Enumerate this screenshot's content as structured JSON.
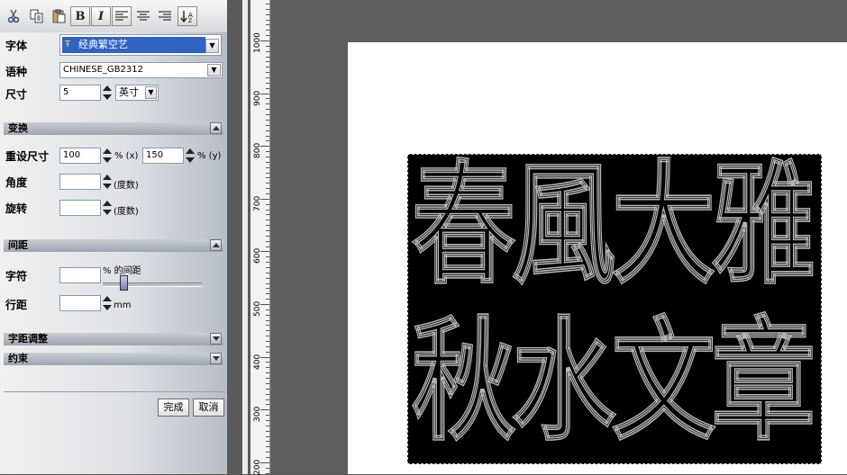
{
  "toolbar": {
    "buttons": [
      {
        "name": "cut-icon",
        "glyph": "✂"
      },
      {
        "name": "copy-icon",
        "glyph": "⎘"
      },
      {
        "name": "paste-icon",
        "glyph": "📋"
      },
      {
        "name": "bold-button",
        "glyph": "B"
      },
      {
        "name": "italic-button",
        "glyph": "I"
      },
      {
        "name": "align-left-icon",
        "glyph": "≡"
      },
      {
        "name": "align-center-icon",
        "glyph": "≡"
      },
      {
        "name": "align-right-icon",
        "glyph": "≡"
      },
      {
        "name": "text-direction-icon",
        "glyph": "↓"
      }
    ]
  },
  "font": {
    "label": "字体",
    "value": "经典繁空艺"
  },
  "script": {
    "label": "语种",
    "value": "CHINESE_GB2312"
  },
  "size": {
    "label": "尺寸",
    "value": "5",
    "unit": "英寸"
  },
  "transform": {
    "title": "变换",
    "resize_label": "重设尺寸",
    "resize_x": "100",
    "resize_x_unit": "% (x)",
    "resize_y": "150",
    "resize_y_unit": "% (y)",
    "angle_label": "角度",
    "angle_value": "",
    "angle_unit": "(度数)",
    "rotate_label": "旋转",
    "rotate_value": "",
    "rotate_unit": "(度数)"
  },
  "spacing": {
    "title": "间距",
    "char_label": "字符",
    "char_value": "",
    "char_unit": "% 的间距",
    "line_label": "行距",
    "line_value": "",
    "line_unit": "mm"
  },
  "kerning": {
    "title": "字距调整"
  },
  "constraint": {
    "title": "约束"
  },
  "actions": {
    "done": "完成",
    "cancel": "取消"
  },
  "ruler": {
    "labels": [
      "1000",
      "900",
      "800",
      "700",
      "600",
      "500",
      "400",
      "300",
      "200"
    ]
  },
  "canvas": {
    "line1": "春風大雅",
    "line2": "秋水文章"
  }
}
